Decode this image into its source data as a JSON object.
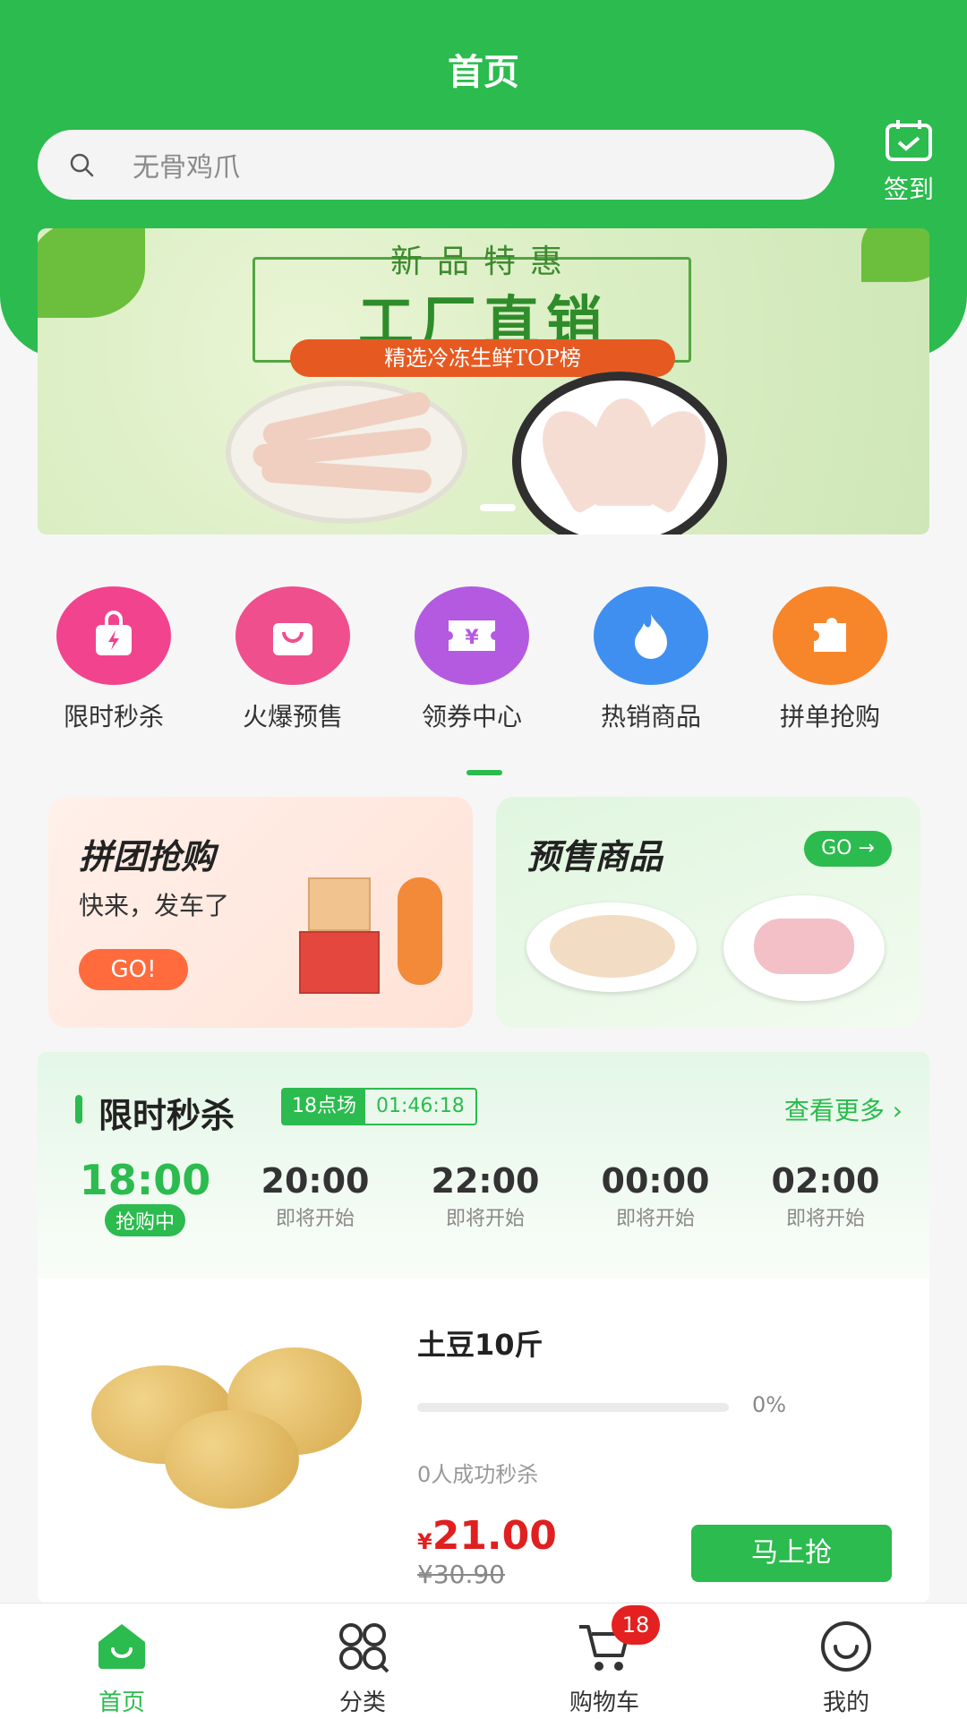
{
  "header": {
    "title": "首页",
    "checkin_label": "签到"
  },
  "search": {
    "placeholder": "无骨鸡爪"
  },
  "banner": {
    "subtitle": "新品特惠",
    "title": "工厂直销",
    "pill": "精选冷冻生鲜TOP榜"
  },
  "categories": [
    {
      "label": "限时秒杀",
      "icon": "lightning-bag-icon",
      "color": "#f2438e"
    },
    {
      "label": "火爆预售",
      "icon": "shopping-bag-icon",
      "color": "#ef4f8c"
    },
    {
      "label": "领券中心",
      "icon": "coupon-icon",
      "color": "#b45ae0"
    },
    {
      "label": "热销商品",
      "icon": "flame-icon",
      "color": "#3f8ff0"
    },
    {
      "label": "拼单抢购",
      "icon": "puzzle-icon",
      "color": "#f7862a"
    }
  ],
  "promo": {
    "group": {
      "title": "拼团抢购",
      "subtitle": "快来，发车了",
      "button": "GO!"
    },
    "presale": {
      "title": "预售商品",
      "button": "GO →"
    }
  },
  "flash_sale": {
    "title": "限时秒杀",
    "session_label": "18点场",
    "countdown": "01:46:18",
    "more": "查看更多 ›",
    "slots": [
      {
        "time": "18:00",
        "status": "抢购中"
      },
      {
        "time": "20:00",
        "status": "即将开始"
      },
      {
        "time": "22:00",
        "status": "即将开始"
      },
      {
        "time": "00:00",
        "status": "即将开始"
      },
      {
        "time": "02:00",
        "status": "即将开始"
      }
    ],
    "product": {
      "name": "土豆10斤",
      "progress": 0,
      "progress_text": "0%",
      "sold_text": "0人成功秒杀",
      "currency": "¥",
      "price": "21.00",
      "original_price": "¥30.90",
      "buy_label": "马上抢"
    }
  },
  "tabbar": {
    "items": [
      {
        "label": "首页",
        "icon": "home-icon"
      },
      {
        "label": "分类",
        "icon": "category-icon"
      },
      {
        "label": "购物车",
        "icon": "cart-icon",
        "badge": "18"
      },
      {
        "label": "我的",
        "icon": "smile-icon"
      }
    ]
  },
  "colors": {
    "brand": "#2bbb4e",
    "price": "#e02020"
  }
}
